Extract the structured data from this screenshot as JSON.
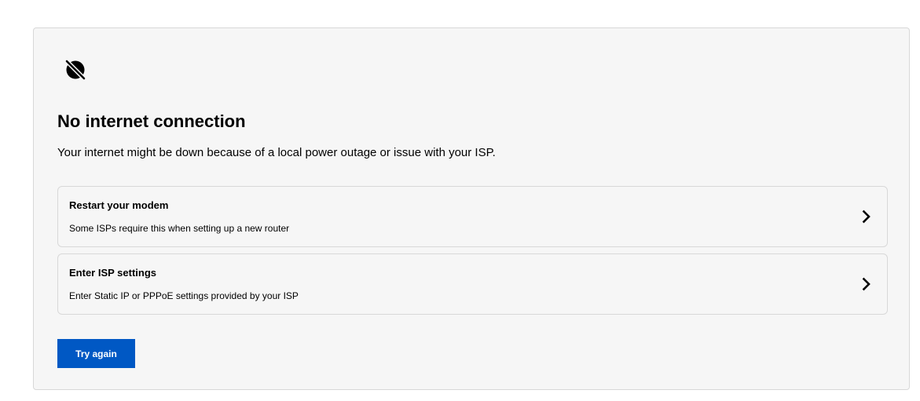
{
  "status": {
    "icon": "no-internet-icon",
    "title": "No internet connection",
    "description": "Your internet might be down because of a local power outage or issue with your ISP."
  },
  "options": [
    {
      "title": "Restart your modem",
      "description": "Some ISPs require this when setting up a new router",
      "icon": "chevron-right-icon"
    },
    {
      "title": "Enter ISP settings",
      "description": "Enter Static IP or PPPoE settings provided by your ISP",
      "icon": "chevron-right-icon"
    }
  ],
  "actions": {
    "try_again_label": "Try again"
  },
  "colors": {
    "primary": "#0058c4",
    "card_background": "#f6f6f6",
    "border": "#d8d8d8",
    "text": "#000000"
  }
}
